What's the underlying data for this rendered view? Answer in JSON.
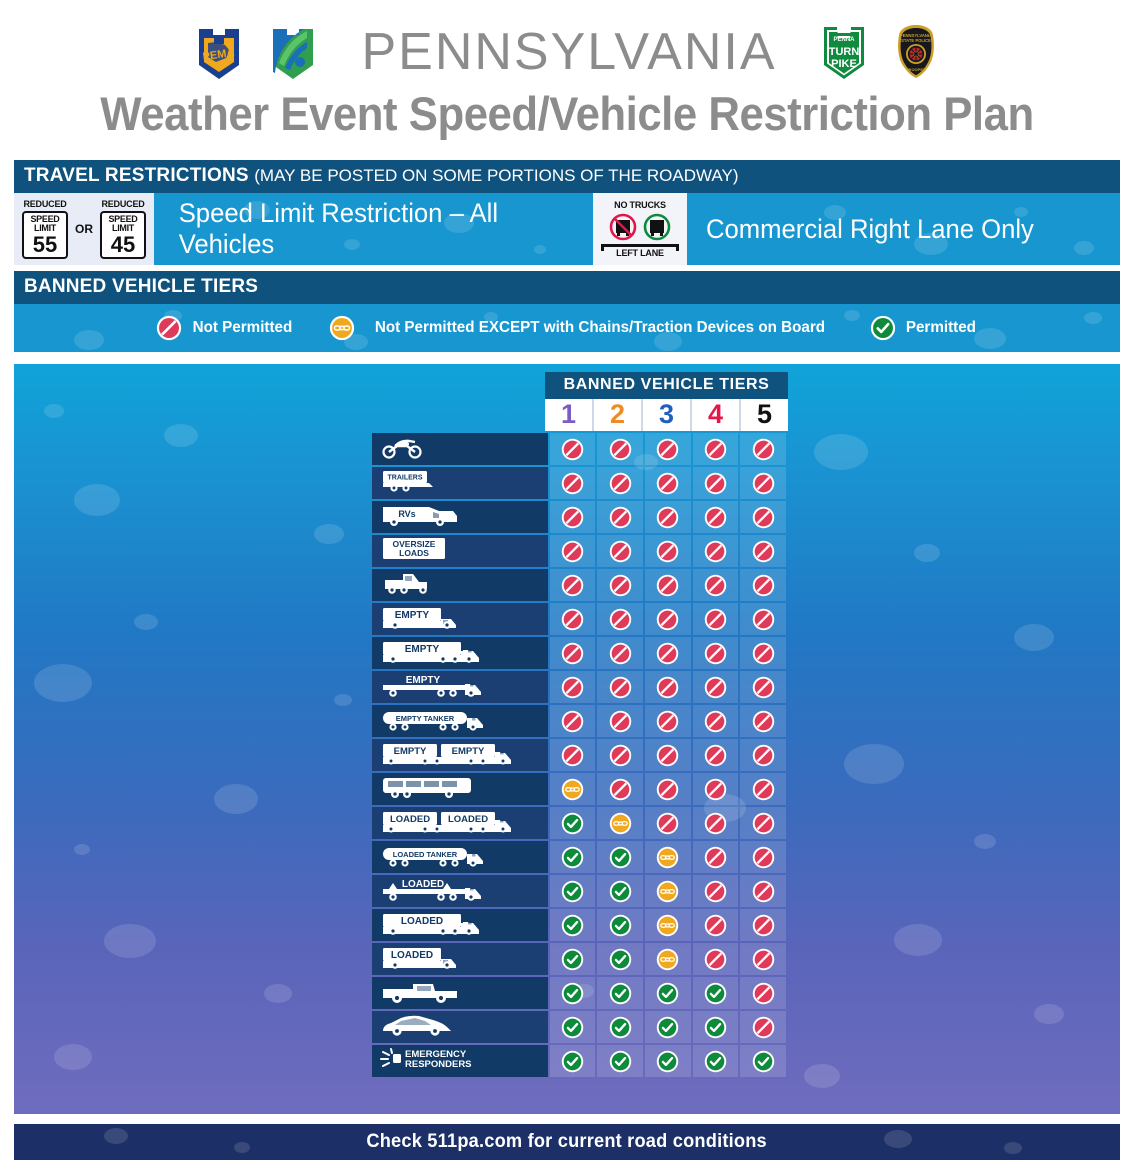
{
  "header": {
    "state_title": "PENNSYLVANIA",
    "plan_title": "Weather Event Speed/Vehicle Restriction Plan",
    "logos": [
      {
        "name": "pema-keystone-logo",
        "text": "PEMA"
      },
      {
        "name": "penndot-keystone-logo",
        "text": ""
      },
      {
        "name": "pa-turnpike-keystone-logo",
        "line1": "PENNA",
        "line2": "TURN",
        "line3": "PIKE"
      },
      {
        "name": "pa-state-police-badge-logo",
        "top": "PENNSYLVANIA STATE POLICE",
        "bottom": "TROOPER"
      }
    ]
  },
  "travel_restrictions": {
    "title": "TRAVEL RESTRICTIONS",
    "subtitle": "(MAY BE POSTED ON SOME PORTIONS OF THE ROADWAY)",
    "speed_signs": {
      "reduced_label": "REDUCED",
      "speed_word": "SPEED",
      "limit_word": "LIMIT",
      "value_1": "55",
      "or_label": "OR",
      "value_2": "45"
    },
    "speed_text": "Speed Limit Restriction – All Vehicles",
    "truck_sign": {
      "top_label": "NO TRUCKS",
      "bottom_label": "LEFT LANE"
    },
    "lane_text": "Commercial Right Lane Only"
  },
  "legend": {
    "title": "BANNED VEHICLE TIERS",
    "items": [
      {
        "icon": "not-permitted-icon",
        "label": "Not Permitted"
      },
      {
        "icon": "chains-required-icon",
        "label": "Not Permitted EXCEPT with Chains/Traction Devices on Board"
      },
      {
        "icon": "permitted-icon",
        "label": "Permitted"
      }
    ]
  },
  "matrix": {
    "header": "BANNED VEHICLE TIERS",
    "tiers": [
      {
        "label": "1",
        "color": "#7c5cc4"
      },
      {
        "label": "2",
        "color": "#ef8b21"
      },
      {
        "label": "3",
        "color": "#1f5fc0"
      },
      {
        "label": "4",
        "color": "#e5174a"
      },
      {
        "label": "5",
        "color": "#111111"
      }
    ],
    "rows": [
      {
        "vehicle": "Motorcycles",
        "icon": "motorcycle-icon",
        "labels": [],
        "marks": [
          "no",
          "no",
          "no",
          "no",
          "no"
        ]
      },
      {
        "vehicle": "Trailers",
        "icon": "trailer-icon",
        "labels": [
          "TRAILERS"
        ],
        "marks": [
          "no",
          "no",
          "no",
          "no",
          "no"
        ]
      },
      {
        "vehicle": "RVs",
        "icon": "rv-icon",
        "labels": [
          "RVs"
        ],
        "marks": [
          "no",
          "no",
          "no",
          "no",
          "no"
        ]
      },
      {
        "vehicle": "Oversize Loads",
        "icon": "oversize-load-icon",
        "labels": [
          "OVERSIZE",
          "LOADS"
        ],
        "marks": [
          "no",
          "no",
          "no",
          "no",
          "no"
        ]
      },
      {
        "vehicle": "Bobtail Tractor",
        "icon": "bobtail-tractor-icon",
        "labels": [],
        "marks": [
          "no",
          "no",
          "no",
          "no",
          "no"
        ]
      },
      {
        "vehicle": "Empty Straight Truck",
        "icon": "empty-box-truck-icon",
        "labels": [
          "EMPTY"
        ],
        "marks": [
          "no",
          "no",
          "no",
          "no",
          "no"
        ]
      },
      {
        "vehicle": "Empty Tractor Trailer",
        "icon": "empty-tractor-trailer-icon",
        "labels": [
          "EMPTY"
        ],
        "marks": [
          "no",
          "no",
          "no",
          "no",
          "no"
        ]
      },
      {
        "vehicle": "Empty Flatbed Tractor Trailer",
        "icon": "empty-flatbed-icon",
        "labels": [
          "EMPTY"
        ],
        "marks": [
          "no",
          "no",
          "no",
          "no",
          "no"
        ]
      },
      {
        "vehicle": "Empty Tanker",
        "icon": "empty-tanker-icon",
        "labels": [
          "EMPTY TANKER"
        ],
        "marks": [
          "no",
          "no",
          "no",
          "no",
          "no"
        ]
      },
      {
        "vehicle": "Empty Double Trailers",
        "icon": "empty-doubles-icon",
        "labels": [
          "EMPTY",
          "EMPTY"
        ],
        "marks": [
          "no",
          "no",
          "no",
          "no",
          "no"
        ]
      },
      {
        "vehicle": "Buses and Motorcoaches",
        "icon": "bus-icon",
        "labels": [],
        "marks": [
          "chains",
          "no",
          "no",
          "no",
          "no"
        ]
      },
      {
        "vehicle": "Loaded Double Trailers",
        "icon": "loaded-doubles-icon",
        "labels": [
          "LOADED",
          "LOADED"
        ],
        "marks": [
          "yes",
          "chains",
          "no",
          "no",
          "no"
        ]
      },
      {
        "vehicle": "Loaded Tanker",
        "icon": "loaded-tanker-icon",
        "labels": [
          "LOADED TANKER"
        ],
        "marks": [
          "yes",
          "yes",
          "chains",
          "no",
          "no"
        ]
      },
      {
        "vehicle": "Loaded Flatbed Tractor Trailer",
        "icon": "loaded-flatbed-icon",
        "labels": [
          "LOADED"
        ],
        "marks": [
          "yes",
          "yes",
          "chains",
          "no",
          "no"
        ]
      },
      {
        "vehicle": "Loaded Tractor Trailer",
        "icon": "loaded-tractor-trailer-icon",
        "labels": [
          "LOADED"
        ],
        "marks": [
          "yes",
          "yes",
          "chains",
          "no",
          "no"
        ]
      },
      {
        "vehicle": "Loaded Straight Truck",
        "icon": "loaded-box-truck-icon",
        "labels": [
          "LOADED"
        ],
        "marks": [
          "yes",
          "yes",
          "chains",
          "no",
          "no"
        ]
      },
      {
        "vehicle": "Pickup Trucks",
        "icon": "pickup-truck-icon",
        "labels": [],
        "marks": [
          "yes",
          "yes",
          "yes",
          "yes",
          "no"
        ]
      },
      {
        "vehicle": "Passenger Cars",
        "icon": "passenger-car-icon",
        "labels": [],
        "marks": [
          "yes",
          "yes",
          "yes",
          "yes",
          "no"
        ]
      },
      {
        "vehicle": "Emergency Responders",
        "icon": "emergency-responder-icon",
        "labels": [
          "EMERGENCY",
          "RESPONDERS"
        ],
        "marks": [
          "yes",
          "yes",
          "yes",
          "yes",
          "yes"
        ]
      }
    ]
  },
  "footer": {
    "text": "Check 511pa.com for current road conditions"
  },
  "colors": {
    "dark_bar": "#10527e",
    "cyan_bar": "#1896cf",
    "footer_navy": "#1c2f66",
    "not_permitted": "#e03a5a",
    "chains": "#f0a81e",
    "permitted": "#0e8a3c",
    "title_gray": "#8c8c8c"
  }
}
